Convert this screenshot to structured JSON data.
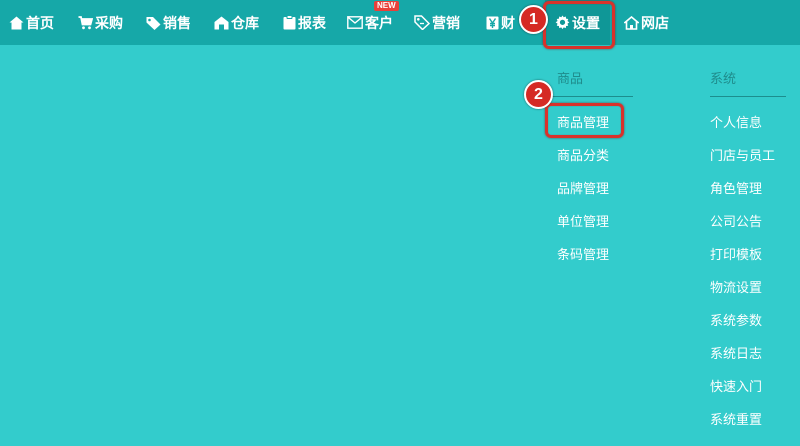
{
  "nav": {
    "items": [
      {
        "label": "首页",
        "icon": "home-icon"
      },
      {
        "label": "采购",
        "icon": "cart-icon"
      },
      {
        "label": "销售",
        "icon": "tag-icon"
      },
      {
        "label": "仓库",
        "icon": "warehouse-icon"
      },
      {
        "label": "报表",
        "icon": "clipboard-icon"
      },
      {
        "label": "客户",
        "icon": "mail-icon",
        "badge": "NEW"
      },
      {
        "label": "营销",
        "icon": "price-tag-icon"
      },
      {
        "label": "财",
        "icon": "yen-icon"
      },
      {
        "label": "设置",
        "icon": "gear-icon",
        "active": true
      },
      {
        "label": "网店",
        "icon": "shop-icon"
      }
    ]
  },
  "annotations": {
    "step1": "1",
    "step2": "2",
    "highlight_color": "#d9322b"
  },
  "dropdown": {
    "goods": {
      "heading": "商品",
      "items": [
        "商品管理",
        "商品分类",
        "品牌管理",
        "单位管理",
        "条码管理"
      ]
    },
    "system": {
      "heading": "系统",
      "items": [
        "个人信息",
        "门店与员工",
        "角色管理",
        "公司公告",
        "打印模板",
        "物流设置",
        "系统参数",
        "系统日志",
        "快速入门",
        "系统重置"
      ]
    }
  },
  "colors": {
    "background": "#33cccc",
    "nav_bar": "#16a8a8",
    "nav_active": "#0f9797",
    "heading_text": "#1f8c8c",
    "link_text": "#ffffff",
    "badge_new": "#e8413a"
  }
}
